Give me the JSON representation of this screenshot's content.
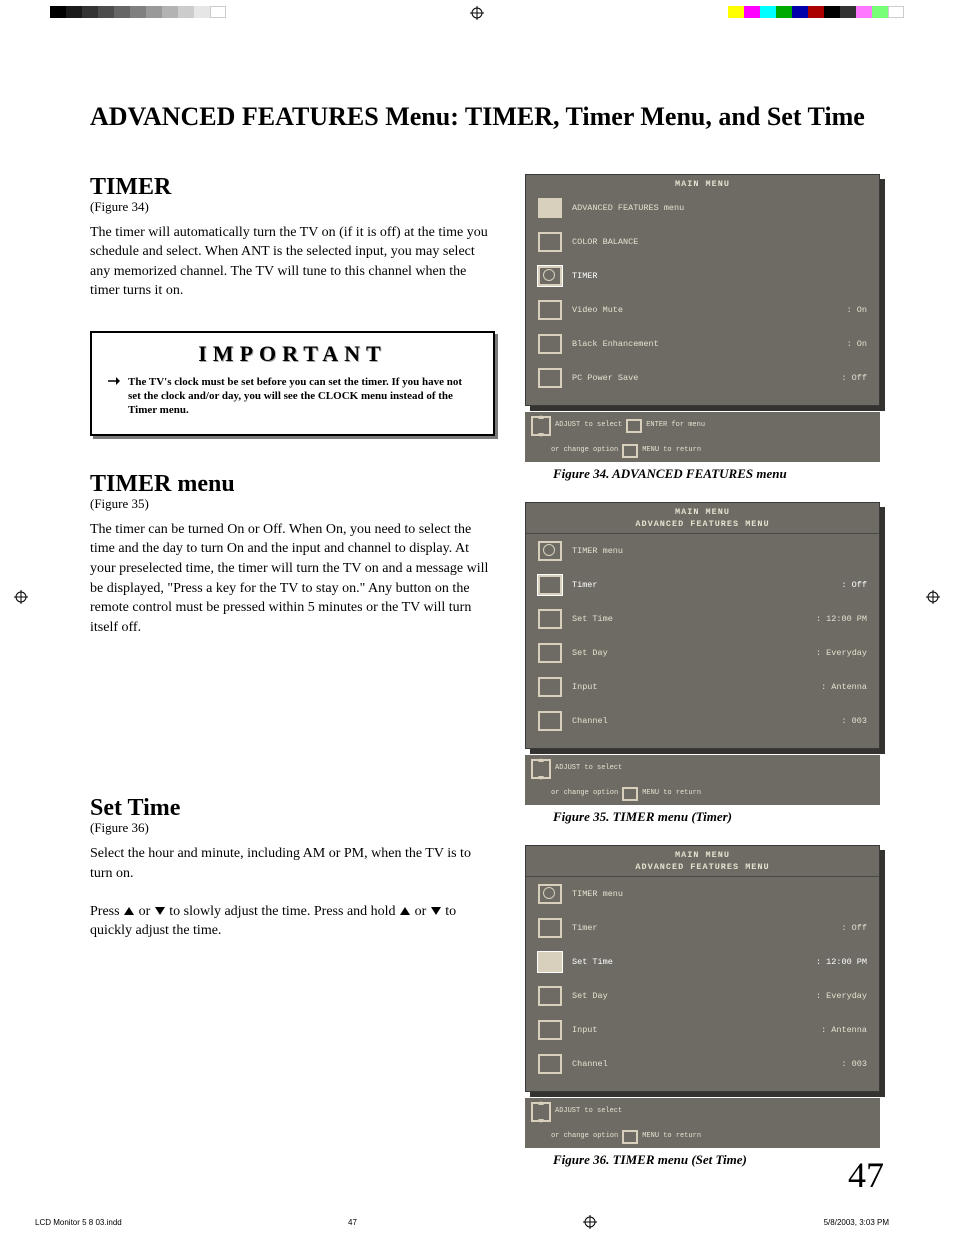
{
  "title": "ADVANCED FEATURES Menu: TIMER, Timer Menu, and Set Time",
  "timer": {
    "heading": "TIMER",
    "figref": "(Figure 34)",
    "para": "The timer will automatically turn the TV on (if it is off) at the time you schedule and select.  When ANT is the selected input, you may select any memorized channel.  The TV will tune to this channel when the timer turns it on."
  },
  "important": {
    "head": "IMPORTANT",
    "body": "The TV's clock must be set before you can set the timer.  If you have not set the clock and/or day, you will see the CLOCK menu instead of the Timer menu."
  },
  "timer_menu": {
    "heading": "TIMER menu",
    "figref": "(Figure 35)",
    "para": "The timer can be turned On or Off.  When On, you need to select the time and the day to turn On and the input and channel to display.  At your preselected time, the timer will turn the TV on and a message will be displayed, \"Press a key for the TV to stay on.\"  Any button on the remote control must be pressed within 5 minutes or the TV will turn itself off."
  },
  "set_time": {
    "heading": "Set Time",
    "figref": "(Figure 36)",
    "para1": "Select the hour and minute, including AM or PM, when the TV is to turn on.",
    "para2a": "Press ",
    "para2b": " or  ",
    "para2c": " to slowly adjust the time.  Press and hold ",
    "para2d": " or ",
    "para2e": " to quickly adjust the time."
  },
  "osd34": {
    "title": "MAIN MENU",
    "rows": [
      {
        "label": "ADVANCED FEATURES menu",
        "val": ""
      },
      {
        "label": "COLOR BALANCE",
        "val": ""
      },
      {
        "label": "TIMER",
        "val": ""
      },
      {
        "label": "Video Mute",
        "val": ": On"
      },
      {
        "label": "Black Enhancement",
        "val": ": On"
      },
      {
        "label": "PC Power Save",
        "val": ": Off"
      }
    ],
    "help1": "ADJUST to select",
    "help2": "ENTER for menu",
    "help3": "or change option",
    "help4": "MENU to return",
    "caption": "Figure 34.  ADVANCED FEATURES menu"
  },
  "osd35": {
    "title": "MAIN MENU",
    "subtitle": "ADVANCED FEATURES MENU",
    "rows": [
      {
        "label": "TIMER menu",
        "val": ""
      },
      {
        "label": "Timer",
        "val": ": Off"
      },
      {
        "label": "Set Time",
        "val": ": 12:00 PM"
      },
      {
        "label": "Set Day",
        "val": ": Everyday"
      },
      {
        "label": "Input",
        "val": ": Antenna"
      },
      {
        "label": "Channel",
        "val": ": 003"
      }
    ],
    "help1": "ADJUST to select",
    "help3": "or change option",
    "help4": "MENU  to  return",
    "caption": "Figure  35.  TIMER menu (Timer)"
  },
  "osd36": {
    "title": "MAIN MENU",
    "subtitle": "ADVANCED FEATURES MENU",
    "rows": [
      {
        "label": "TIMER menu",
        "val": ""
      },
      {
        "label": "Timer",
        "val": ": Off"
      },
      {
        "label": "Set Time",
        "val": ": 12:00 PM"
      },
      {
        "label": "Set Day",
        "val": ": Everyday"
      },
      {
        "label": "Input",
        "val": ": Antenna"
      },
      {
        "label": "Channel",
        "val": ": 003"
      }
    ],
    "help1": "ADJUST to select",
    "help3": "or change option",
    "help4": "MENU to return",
    "caption": "Figure  36.  TIMER menu (Set Time)"
  },
  "page_number": "47",
  "footer": {
    "file": "LCD Monitor 5 8 03.indd",
    "pg": "47",
    "date": "5/8/2003, 3:03 PM"
  }
}
